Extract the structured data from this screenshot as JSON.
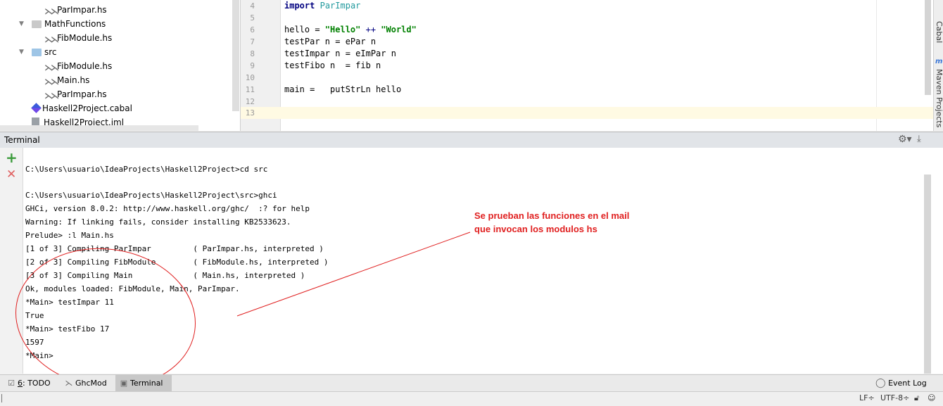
{
  "project_tree": {
    "items": [
      {
        "label": "ParImpar.hs",
        "icon": "haskell-file-icon"
      },
      {
        "label": "MathFunctions",
        "icon": "folder-icon"
      },
      {
        "label": "FibModule.hs",
        "icon": "haskell-file-icon"
      },
      {
        "label": "src",
        "icon": "source-folder-icon"
      },
      {
        "label": "FibModule.hs",
        "icon": "haskell-file-icon"
      },
      {
        "label": "Main.hs",
        "icon": "haskell-file-icon"
      },
      {
        "label": "ParImpar.hs",
        "icon": "haskell-file-icon"
      },
      {
        "label": "Haskell2Project.cabal",
        "icon": "cabal-file-icon"
      },
      {
        "label": "Haskell2Project.iml",
        "icon": "module-file-icon"
      }
    ]
  },
  "editor": {
    "lines": [
      {
        "num": "4",
        "code": "import ParImpar"
      },
      {
        "num": "5",
        "code": ""
      },
      {
        "num": "6",
        "code": "hello = \"Hello\" ++ \"World\""
      },
      {
        "num": "7",
        "code": "testPar n = ePar n"
      },
      {
        "num": "8",
        "code": "testImpar n = eImPar n"
      },
      {
        "num": "9",
        "code": "testFibo n  = fib n"
      },
      {
        "num": "10",
        "code": ""
      },
      {
        "num": "11",
        "code": "main =   putStrLn hello"
      },
      {
        "num": "12",
        "code": ""
      },
      {
        "num": "13",
        "code": ""
      }
    ],
    "tokens": {
      "import_kw": "import",
      "module_name": "ParImpar",
      "hello_lhs": "hello = ",
      "str_hello": "\"Hello\"",
      "concat_op": " ++ ",
      "str_world": "\"World\""
    }
  },
  "right_strip": {
    "cabal_label": "Cabal",
    "maven_label": "Maven Projects",
    "maven_icon": "m"
  },
  "terminal": {
    "title": "Terminal",
    "lines": [
      "",
      "C:\\Users\\usuario\\IdeaProjects\\Haskell2Project>cd src",
      "",
      "C:\\Users\\usuario\\IdeaProjects\\Haskell2Project\\src>ghci",
      "GHCi, version 8.0.2: http://www.haskell.org/ghc/  :? for help",
      "Warning: If linking fails, consider installing KB2533623.",
      "Prelude> :l Main.hs",
      "[1 of 3] Compiling ParImpar         ( ParImpar.hs, interpreted )",
      "[2 of 3] Compiling FibModule        ( FibModule.hs, interpreted )",
      "[3 of 3] Compiling Main             ( Main.hs, interpreted )",
      "Ok, modules loaded: FibModule, Main, ParImpar.",
      "*Main> testImpar 11",
      "True",
      "*Main> testFibo 17",
      "1597",
      "*Main>"
    ]
  },
  "annotation": {
    "line1": "Se prueban las funciones en el mail",
    "line2": "que invocan los modulos hs",
    "color": "#e02020"
  },
  "bottom_tools": {
    "todo_num": "6",
    "todo_label": ": TODO",
    "ghcmod_label": "GhcMod",
    "terminal_label": "Terminal",
    "event_log_label": "Event Log"
  },
  "status_bar": {
    "line_sep": "LF÷",
    "encoding": "UTF-8÷"
  }
}
